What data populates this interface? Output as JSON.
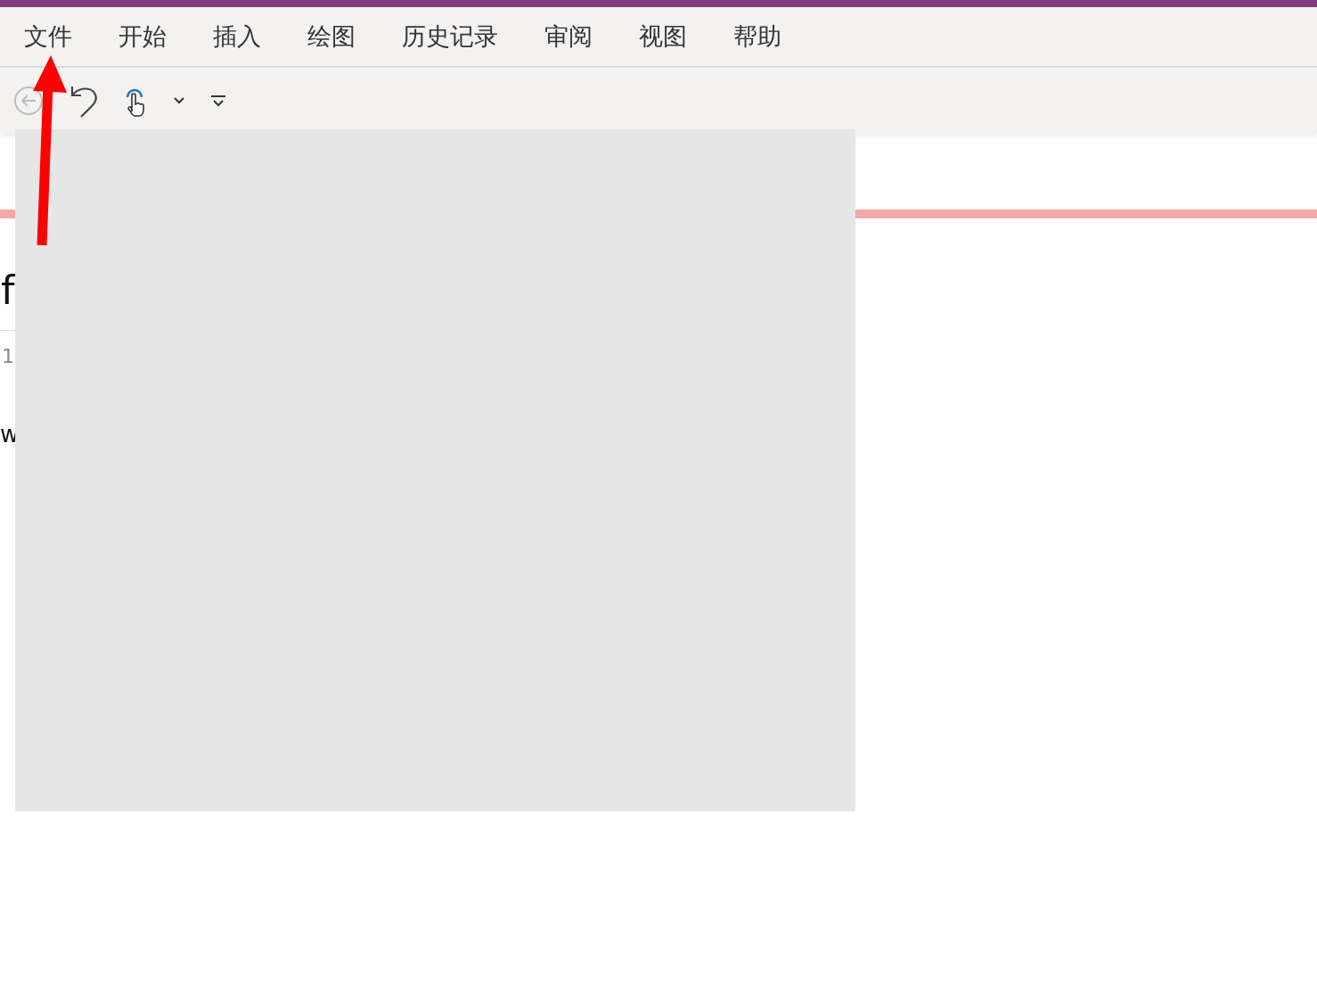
{
  "menu_tabs": [
    {
      "label": "文件",
      "selected": false
    },
    {
      "label": "开始",
      "selected": false
    },
    {
      "label": "插入",
      "selected": false
    },
    {
      "label": "绘图",
      "selected": false
    },
    {
      "label": "历史记录",
      "selected": false
    },
    {
      "label": "审阅",
      "selected": false
    },
    {
      "label": "视图",
      "selected": false
    },
    {
      "label": "帮助",
      "selected": false
    }
  ],
  "page": {
    "title_fragment": "f",
    "date_fragment": "1",
    "body_fragment": "w"
  }
}
